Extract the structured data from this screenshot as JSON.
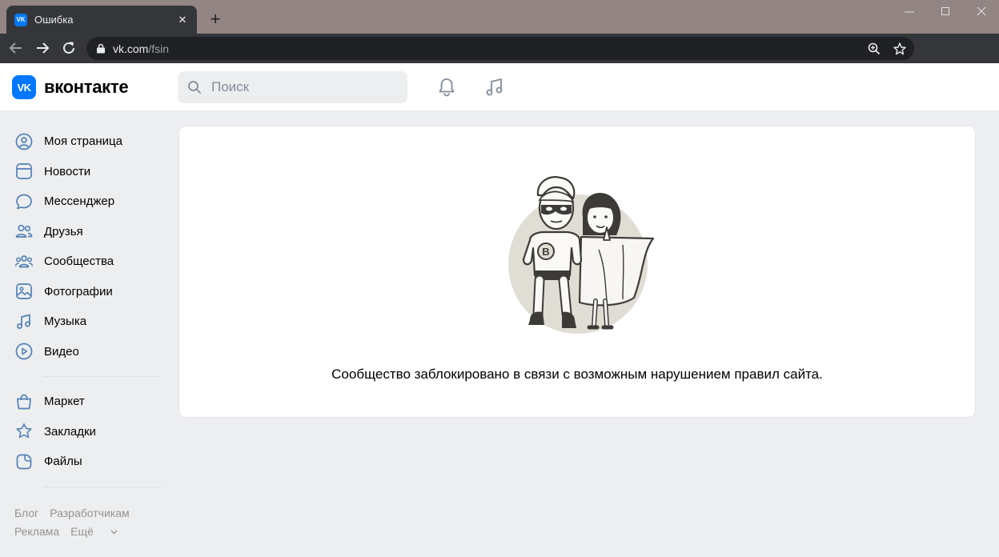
{
  "browser": {
    "tab_title": "Ошибка",
    "tab_favicon": "VK",
    "new_tab_label": "+",
    "close_tab_label": "✕",
    "url_host": "vk.com",
    "url_path": "/fsin"
  },
  "header": {
    "logo_mark": "VK",
    "logo_text": "вконтакте",
    "search_placeholder": "Поиск"
  },
  "sidebar": {
    "items": [
      {
        "label": "Моя страница",
        "icon": "user-circle-icon"
      },
      {
        "label": "Новости",
        "icon": "news-icon"
      },
      {
        "label": "Мессенджер",
        "icon": "message-icon"
      },
      {
        "label": "Друзья",
        "icon": "friends-icon"
      },
      {
        "label": "Сообщества",
        "icon": "communities-icon"
      },
      {
        "label": "Фотографии",
        "icon": "photo-icon"
      },
      {
        "label": "Музыка",
        "icon": "music-icon"
      },
      {
        "label": "Видео",
        "icon": "video-icon"
      }
    ],
    "items2": [
      {
        "label": "Маркет",
        "icon": "market-icon"
      },
      {
        "label": "Закладки",
        "icon": "bookmark-icon"
      },
      {
        "label": "Файлы",
        "icon": "file-icon"
      }
    ],
    "footer": {
      "blog": "Блог",
      "developers": "Разработчикам",
      "ads": "Реклама",
      "more": "Ещё"
    }
  },
  "content": {
    "message": "Сообщество заблокировано в связи с возможным нарушением правил сайта."
  },
  "colors": {
    "accent": "#0077ff",
    "icon_blue": "#5181b8",
    "page_bg": "#edeef0"
  }
}
